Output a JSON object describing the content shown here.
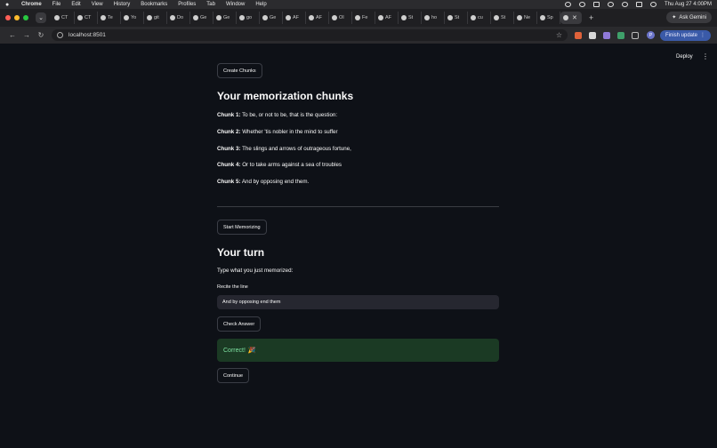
{
  "menubar": {
    "app": "Chrome",
    "items": [
      "File",
      "Edit",
      "View",
      "History",
      "Bookmarks",
      "Profiles",
      "Tab",
      "Window",
      "Help"
    ],
    "clock": "Thu Aug 27  4:00PM"
  },
  "tabs": [
    {
      "label": "CT"
    },
    {
      "label": "CT"
    },
    {
      "label": "Te"
    },
    {
      "label": "Yo"
    },
    {
      "label": "git"
    },
    {
      "label": "Do"
    },
    {
      "label": "Ge"
    },
    {
      "label": "Ge"
    },
    {
      "label": "go"
    },
    {
      "label": "Ge"
    },
    {
      "label": "AF"
    },
    {
      "label": "AF"
    },
    {
      "label": "OI"
    },
    {
      "label": "Fe"
    },
    {
      "label": "AF"
    },
    {
      "label": "St"
    },
    {
      "label": "ho"
    },
    {
      "label": "St"
    },
    {
      "label": "cu"
    },
    {
      "label": "St"
    },
    {
      "label": "Ne"
    },
    {
      "label": "Sp"
    }
  ],
  "browser": {
    "ask_gemini": "Ask Gemini",
    "url": "localhost:8501",
    "finish_update": "Finish update",
    "profile_initial": "P"
  },
  "app_header": {
    "deploy": "Deploy"
  },
  "main": {
    "create_chunks_label": "Create Chunks",
    "chunks_heading": "Your memorization chunks",
    "chunks": [
      {
        "label": "Chunk 1:",
        "text": "To be, or not to be, that is the question:"
      },
      {
        "label": "Chunk 2:",
        "text": "Whether 'tis nobler in the mind to suffer"
      },
      {
        "label": "Chunk 3:",
        "text": "The slings and arrows of outrageous fortune,"
      },
      {
        "label": "Chunk 4:",
        "text": "Or to take arms against a sea of troubles"
      },
      {
        "label": "Chunk 5:",
        "text": "And by opposing end them."
      }
    ],
    "start_label": "Start Memorizing",
    "turn_heading": "Your turn",
    "prompt": "Type what you just memorized:",
    "input_label": "Recite the line",
    "input_value": "And by opposing end them",
    "check_label": "Check Answer",
    "success_text": "Correct!",
    "success_emoji": "🎉",
    "continue_label": "Continue"
  }
}
